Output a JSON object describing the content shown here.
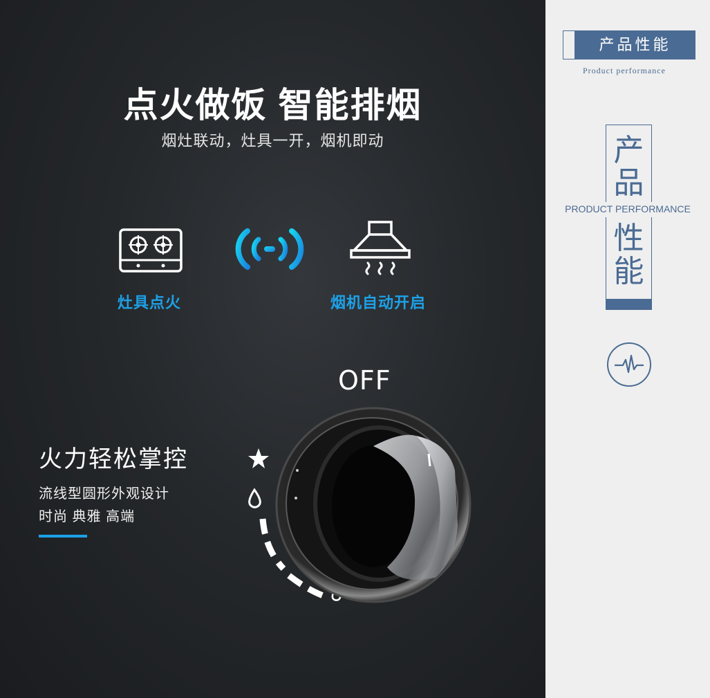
{
  "main": {
    "headline": "点火做饭 智能排烟",
    "subhead": "烟灶联动，灶具一开，烟机即动",
    "features": [
      {
        "label": "灶具点火",
        "icon": "gas-stove-icon"
      },
      {
        "icon": "wireless-signal-icon"
      },
      {
        "label": "烟机自动开启",
        "icon": "range-hood-icon"
      }
    ],
    "fire": {
      "title": "火力轻松掌控",
      "desc_line1": "流线型圆形外观设计",
      "desc_line2": "时尚 典雅 高端"
    },
    "knob": {
      "off_label": "OFF",
      "icon": "control-knob-icon"
    }
  },
  "sidebar": {
    "section_title": "产品性能",
    "section_subtitle": "Product performance",
    "vertical_chars": [
      "产",
      "品",
      "性",
      "能"
    ],
    "vertical_english": "PRODUCT PERFORMANCE",
    "icon": "pulse-icon"
  },
  "colors": {
    "accent_blue": "#1da1e8",
    "brand_navy": "#4a6b93",
    "panel_dark": "#25282b",
    "sidebar_bg": "#efefef"
  }
}
